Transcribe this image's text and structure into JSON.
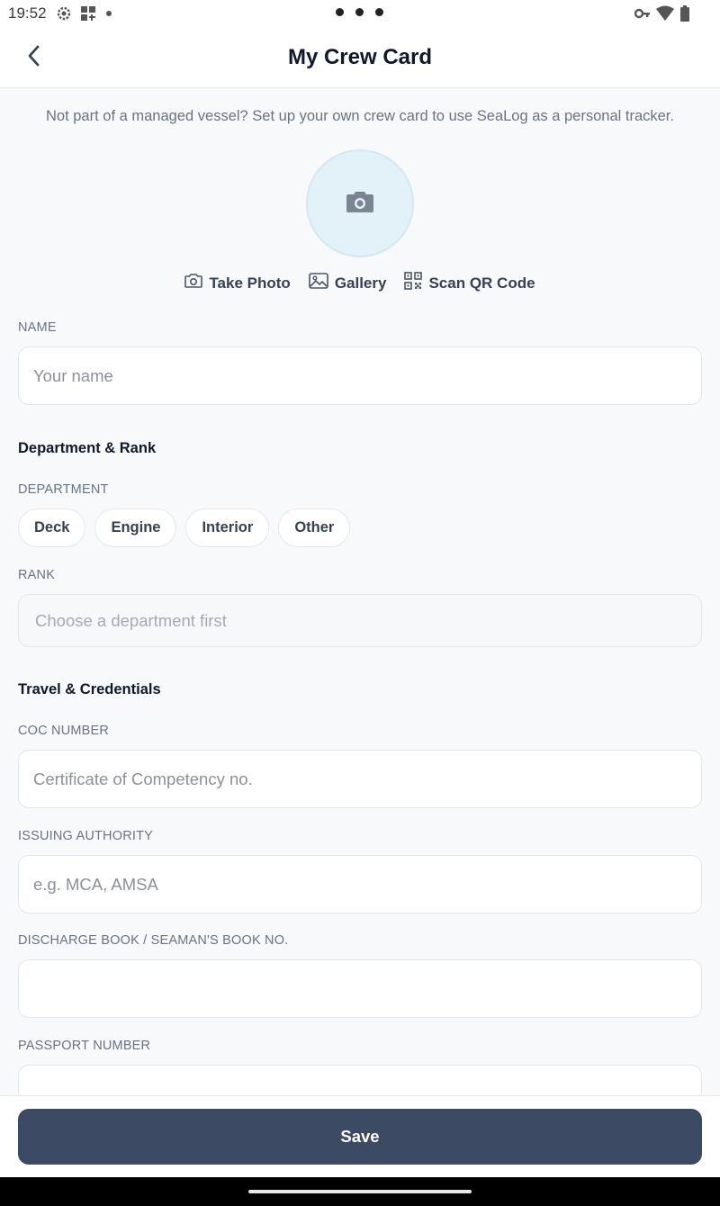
{
  "status_bar": {
    "time": "19:52"
  },
  "header": {
    "title": "My Crew Card"
  },
  "intro_text": "Not part of a managed vessel? Set up your own crew card to use SeaLog as a personal tracker.",
  "photo_actions": {
    "take_photo": "Take Photo",
    "gallery": "Gallery",
    "scan_qr": "Scan QR Code"
  },
  "name_field": {
    "label": "NAME",
    "placeholder": "Your name",
    "value": ""
  },
  "department_rank": {
    "heading": "Department & Rank",
    "department_label": "DEPARTMENT",
    "departments": [
      "Deck",
      "Engine",
      "Interior",
      "Other"
    ],
    "rank_label": "RANK",
    "rank_placeholder": "Choose a department first"
  },
  "travel_credentials": {
    "heading": "Travel & Credentials",
    "coc_label": "COC NUMBER",
    "coc_placeholder": "Certificate of Competency no.",
    "authority_label": "ISSUING AUTHORITY",
    "authority_placeholder": "e.g. MCA, AMSA",
    "discharge_label": "DISCHARGE BOOK / SEAMAN'S BOOK NO.",
    "discharge_value": "",
    "passport_label": "PASSPORT NUMBER",
    "passport_value": ""
  },
  "footer": {
    "save_label": "Save"
  },
  "colors": {
    "primary_button": "#3d4a63",
    "avatar_bg": "#e3f1f8"
  }
}
